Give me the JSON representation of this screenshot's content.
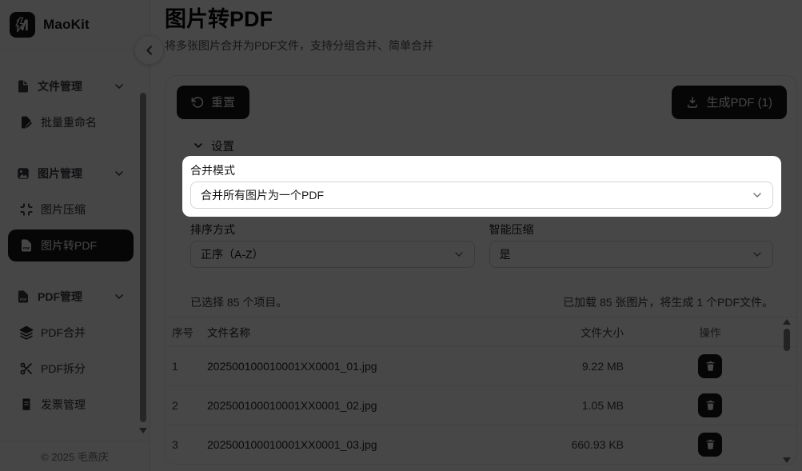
{
  "app": {
    "name": "MaoKit",
    "copyright": "© 2025 毛燕庆"
  },
  "sidebar": {
    "groups": [
      {
        "label": "文件管理",
        "items": [
          {
            "label": "批量重命名"
          }
        ]
      },
      {
        "label": "图片管理",
        "items": [
          {
            "label": "图片压缩"
          },
          {
            "label": "图片转PDF"
          }
        ]
      },
      {
        "label": "PDF管理",
        "items": [
          {
            "label": "PDF合并"
          },
          {
            "label": "PDF拆分"
          },
          {
            "label": "发票管理"
          }
        ]
      }
    ]
  },
  "page": {
    "title": "图片转PDF",
    "subtitle": "将多张图片合并为PDF文件，支持分组合并、简单合并"
  },
  "toolbar": {
    "reset_label": "重置",
    "generate_label": "生成PDF (1)"
  },
  "settings": {
    "section_label": "设置",
    "merge_mode_label": "合并模式",
    "merge_mode_value": "合并所有图片为一个PDF",
    "sort_label": "排序方式",
    "sort_value": "正序（A-Z）",
    "compress_label": "智能压缩",
    "compress_value": "是"
  },
  "file_list": {
    "selected_info": "已选择 85 个项目。",
    "loaded_info": "已加载 85 张图片，将生成 1 个PDF文件。",
    "columns": {
      "index": "序号",
      "name": "文件名称",
      "size": "文件大小",
      "actions": "操作"
    },
    "rows": [
      {
        "index": "1",
        "name": "202500100010001XX0001_01.jpg",
        "size": "9.22 MB"
      },
      {
        "index": "2",
        "name": "202500100010001XX0001_02.jpg",
        "size": "1.05 MB"
      },
      {
        "index": "3",
        "name": "202500100010001XX0001_03.jpg",
        "size": "660.93 KB"
      }
    ]
  },
  "colors": {
    "accent_dark": "#18181b",
    "overlay": "rgba(0,0,0,0.72)",
    "highlight_bg": "#ffffff"
  }
}
